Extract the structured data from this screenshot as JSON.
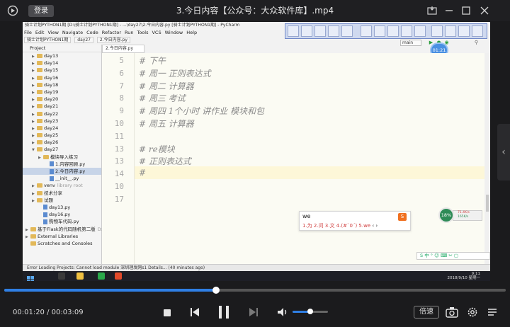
{
  "player": {
    "login_label": "登录",
    "title": "3.今日内容【公众号：大众软件库】.mp4",
    "current_time": "00:01:20",
    "total_time": "00:03:09",
    "time_separator": "/",
    "progress_fraction": 0.423,
    "volume_fraction": 0.5,
    "speed_label": "倍速",
    "accent_color": "#2f7fe4"
  },
  "pycharm": {
    "window_title": "骑士计划PYTHON1期 [D:\\骑士计划PYTHON1期] - ...\\day27\\2.今日内容.py [骑士计划PYTHON1期] - PyCharm",
    "menu": [
      "File",
      "Edit",
      "View",
      "Navigate",
      "Code",
      "Refactor",
      "Run",
      "Tools",
      "VCS",
      "Window",
      "Help"
    ],
    "breadcrumb": [
      "骑士计划PYTHON1期",
      "day27",
      "2.今日内容.py"
    ],
    "run_config": "main",
    "timestamp_badge": "01:21",
    "project_header": "Project",
    "tree": [
      {
        "label": "day13",
        "type": "folder",
        "indent": 1,
        "arrow": "▶"
      },
      {
        "label": "day14",
        "type": "folder",
        "indent": 1,
        "arrow": "▶"
      },
      {
        "label": "day15",
        "type": "folder",
        "indent": 1,
        "arrow": "▶"
      },
      {
        "label": "day16",
        "type": "folder",
        "indent": 1,
        "arrow": "▶"
      },
      {
        "label": "day18",
        "type": "folder",
        "indent": 1,
        "arrow": "▶"
      },
      {
        "label": "day19",
        "type": "folder",
        "indent": 1,
        "arrow": "▶"
      },
      {
        "label": "day20",
        "type": "folder",
        "indent": 1,
        "arrow": "▶"
      },
      {
        "label": "day21",
        "type": "folder",
        "indent": 1,
        "arrow": "▶"
      },
      {
        "label": "day22",
        "type": "folder",
        "indent": 1,
        "arrow": "▶"
      },
      {
        "label": "day23",
        "type": "folder",
        "indent": 1,
        "arrow": "▶"
      },
      {
        "label": "day24",
        "type": "folder",
        "indent": 1,
        "arrow": "▶"
      },
      {
        "label": "day25",
        "type": "folder",
        "indent": 1,
        "arrow": "▶"
      },
      {
        "label": "day26",
        "type": "folder",
        "indent": 1,
        "arrow": "▶"
      },
      {
        "label": "day27",
        "type": "folder",
        "indent": 1,
        "arrow": "▼"
      },
      {
        "label": "模块导入练习",
        "type": "folder",
        "indent": 2,
        "arrow": "▶"
      },
      {
        "label": "1.内容回顾.py",
        "type": "file",
        "indent": 3,
        "arrow": ""
      },
      {
        "label": "2.今日内容.py",
        "type": "file",
        "indent": 3,
        "arrow": "",
        "selected": true
      },
      {
        "label": "__init__.py",
        "type": "file",
        "indent": 3,
        "arrow": ""
      },
      {
        "label": "venv",
        "type": "folder",
        "indent": 1,
        "arrow": "▶",
        "note": "library root"
      },
      {
        "label": "技术分享",
        "type": "folder",
        "indent": 1,
        "arrow": "▶"
      },
      {
        "label": "试题",
        "type": "folder",
        "indent": 1,
        "arrow": "▶"
      },
      {
        "label": "day13.py",
        "type": "file",
        "indent": 2,
        "arrow": ""
      },
      {
        "label": "day16.py",
        "type": "file",
        "indent": 2,
        "arrow": ""
      },
      {
        "label": "购物车代码.py",
        "type": "file",
        "indent": 2,
        "arrow": ""
      },
      {
        "label": "基于Flask的代码随机第二版",
        "type": "folder",
        "indent": 0,
        "arrow": "▶",
        "note": "D:\\骑"
      },
      {
        "label": "External Libraries",
        "type": "folder",
        "indent": 0,
        "arrow": "▶"
      },
      {
        "label": "Scratches and Consoles",
        "type": "folder",
        "indent": 0,
        "arrow": ""
      }
    ],
    "editor_tab": "2.今日内容.py",
    "lines": [
      {
        "num": "5",
        "text": "# 下午"
      },
      {
        "num": "6",
        "text": "# 周一   正则表达式"
      },
      {
        "num": "7",
        "text": "# 周二   计算器"
      },
      {
        "num": "8",
        "text": "# 周三   考试"
      },
      {
        "num": "9",
        "text": "# 周四   1个小时 讲作业 模块和包"
      },
      {
        "num": "10",
        "text": "# 周五   计算器"
      },
      {
        "num": "11",
        "text": ""
      },
      {
        "num": "13",
        "text": "# re模块"
      },
      {
        "num": "13",
        "text": "# 正则表达式"
      },
      {
        "num": "14",
        "text": "#"
      },
      {
        "num": "10",
        "text": ""
      },
      {
        "num": "17",
        "text": ""
      }
    ],
    "ime": {
      "input": "we",
      "candidates": "1.为  2.问  3.文  4.(#`0´)  5.we",
      "nav": "‹ ›",
      "logo": "S"
    },
    "net": {
      "percent": "18%",
      "up": "71.4K/s",
      "down": "165K/s"
    },
    "status": "Error Loading Projects: Cannot load module 深圳理发网s1 Details... (40 minutes ago)",
    "sogou_bar": "S 中 ° ☺ ⌨ ✂ ▢",
    "clock_time": "9:11",
    "clock_date": "2018/9/10 星期一"
  },
  "icons": {
    "logo": "player-logo-icon",
    "minimize": "minimize-icon",
    "maximize": "maximize-icon",
    "close": "close-icon"
  }
}
